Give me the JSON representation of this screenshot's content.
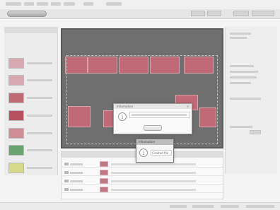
{
  "window": {
    "title": ""
  },
  "left_panel": {
    "thumbnails": [
      {
        "color": "#d8a9b0"
      },
      {
        "color": "#d8a9b0"
      },
      {
        "color": "#c06a76"
      },
      {
        "color": "#b8505f"
      },
      {
        "color": "#cf8d96"
      },
      {
        "color": "#69a46f"
      },
      {
        "color": "#d6d88a"
      }
    ]
  },
  "dialog_info": {
    "title": "Information",
    "close": "×",
    "icon": "i"
  },
  "dialog_info_small": {
    "title": "Information",
    "icon": "i",
    "message": "Created file ..."
  },
  "colors": {
    "block": "#bf6a76",
    "canvas": "#6f6f6f",
    "panel": "#ececec"
  }
}
